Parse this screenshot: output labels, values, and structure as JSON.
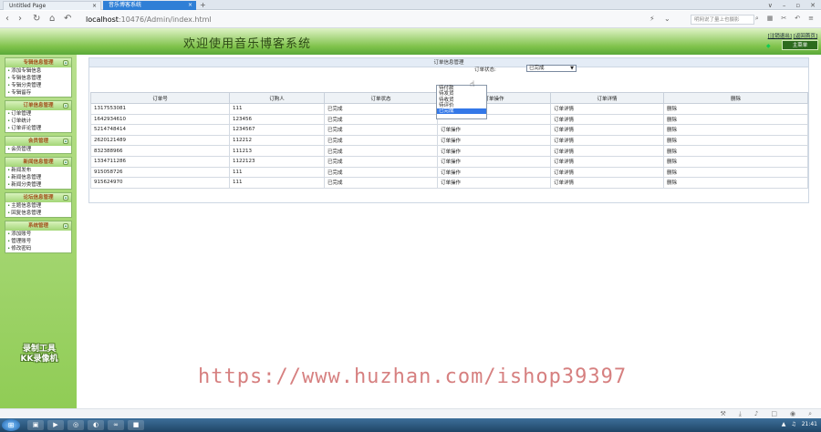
{
  "browser": {
    "tabs": [
      {
        "label": "Untitled Page"
      },
      {
        "label": "音乐博客系统"
      }
    ],
    "new_tab": "+",
    "url_host": "localhost",
    "url_path": ":10476/Admin/index.html",
    "right_search_placeholder": "明网说了量上也摄影",
    "window_buttons": [
      "∨",
      "–",
      "▫",
      "✕"
    ]
  },
  "header": {
    "title": "欢迎使用音乐博客系统",
    "logout": "[注销退出]",
    "home": "[返回首页]",
    "main_menu": "主菜单"
  },
  "sidebar": {
    "groups": [
      {
        "title": "专辑信息管理",
        "items": [
          "添加专辑信息",
          "专辑信息管理",
          "专辑分类管理",
          "专辑留存"
        ]
      },
      {
        "title": "订单信息管理",
        "items": [
          "订单管理",
          "订单统计",
          "订单评论管理"
        ]
      },
      {
        "title": "会员管理",
        "items": [
          "会员管理"
        ]
      },
      {
        "title": "新闻信息管理",
        "items": [
          "新闻发布",
          "新闻信息管理",
          "新闻分类管理"
        ]
      },
      {
        "title": "论坛信息管理",
        "items": [
          "主题信息管理",
          "回复信息管理"
        ]
      },
      {
        "title": "系统管理",
        "items": [
          "添加账号",
          "管理账号",
          "修改密码"
        ]
      }
    ],
    "watermark": [
      "录制工具",
      "KK录像机"
    ]
  },
  "panel": {
    "title": "订单信息管理",
    "filter_label": "订单状态:",
    "filter_value": "已完成",
    "dropdown_options": [
      "待付款",
      "待发货",
      "待收货",
      "待评价",
      "已完成"
    ],
    "dropdown_selected_index": 4,
    "columns": [
      "订单号",
      "订购人",
      "订单状态",
      "订单操作",
      "订单详情",
      "删除"
    ],
    "rows": [
      [
        "1317553081",
        "111",
        "已完成",
        "",
        "订单详情",
        "删除"
      ],
      [
        "1642934610",
        "123456",
        "已完成",
        "",
        "订单详情",
        "删除"
      ],
      [
        "5214748414",
        "1234567",
        "已完成",
        "订单操作",
        "订单详情",
        "删除"
      ],
      [
        "2620121489",
        "112212",
        "已完成",
        "订单操作",
        "订单详情",
        "删除"
      ],
      [
        "832388966",
        "111213",
        "已完成",
        "订单操作",
        "订单详情",
        "删除"
      ],
      [
        "1334711286",
        "1122123",
        "已完成",
        "订单操作",
        "订单详情",
        "删除"
      ],
      [
        "915058726",
        "111",
        "已完成",
        "订单操作",
        "订单详情",
        "删除"
      ],
      [
        "915624970",
        "111",
        "已完成",
        "订单操作",
        "订单详情",
        "删除"
      ]
    ]
  },
  "overlay_watermark": "https://www.huzhan.com/ishop39397",
  "taskbar": {
    "clock": "21:41"
  }
}
